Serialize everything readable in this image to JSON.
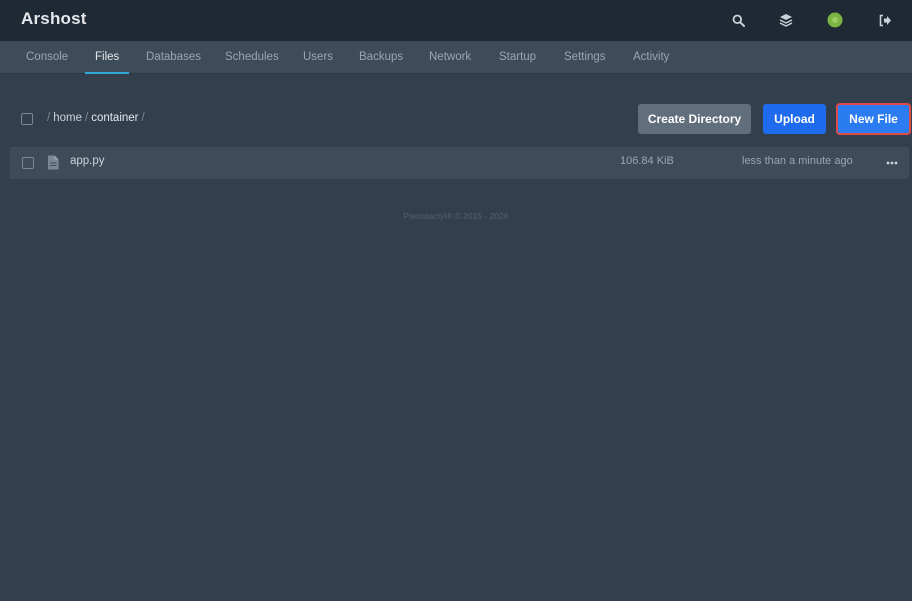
{
  "app": {
    "brand": "Arshost"
  },
  "topbar": {
    "icons": [
      "search-icon",
      "layers-icon",
      "avatar",
      "logout-icon"
    ],
    "avatar_color": "#7cb342"
  },
  "nav": {
    "tabs": [
      {
        "label": "Console"
      },
      {
        "label": "Files"
      },
      {
        "label": "Databases"
      },
      {
        "label": "Schedules"
      },
      {
        "label": "Users"
      },
      {
        "label": "Backups"
      },
      {
        "label": "Network"
      },
      {
        "label": "Startup"
      },
      {
        "label": "Settings"
      },
      {
        "label": "Activity"
      }
    ],
    "active": "Files"
  },
  "breadcrumb": {
    "separator": "/",
    "segments": [
      "home",
      "container"
    ]
  },
  "toolbar": {
    "create_directory_label": "Create Directory",
    "upload_label": "Upload",
    "new_file_label": "New File"
  },
  "files": [
    {
      "name": "app.py",
      "size": "106.84 KiB",
      "modified": "less than a minute ago",
      "icon": "file-icon"
    }
  ],
  "footer": {
    "text": "Pterodactyl® © 2015 - 2026"
  },
  "colors": {
    "accent": "#2ea8d6",
    "primary_button": "#1f6bed",
    "highlight_outline": "#e14a4a"
  }
}
